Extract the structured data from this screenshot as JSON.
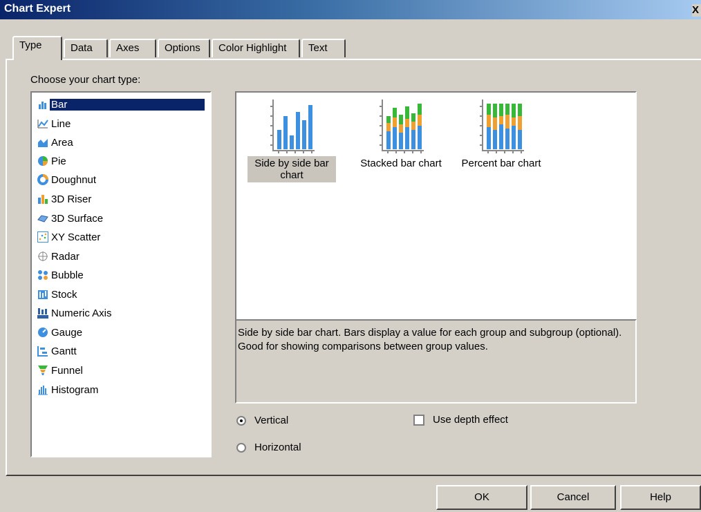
{
  "window": {
    "title": "Chart Expert",
    "close_symbol": "X"
  },
  "tabs": [
    {
      "label": "Type",
      "active": true
    },
    {
      "label": "Data"
    },
    {
      "label": "Axes"
    },
    {
      "label": "Options"
    },
    {
      "label": "Color Highlight"
    },
    {
      "label": "Text"
    }
  ],
  "chart_type_prompt": "Choose your chart type:",
  "chart_types": [
    {
      "label": "Bar",
      "icon": "bar-chart-icon",
      "selected": true
    },
    {
      "label": "Line",
      "icon": "line-chart-icon"
    },
    {
      "label": "Area",
      "icon": "area-chart-icon"
    },
    {
      "label": "Pie",
      "icon": "pie-chart-icon"
    },
    {
      "label": "Doughnut",
      "icon": "doughnut-chart-icon"
    },
    {
      "label": "3D Riser",
      "icon": "3d-riser-icon"
    },
    {
      "label": "3D Surface",
      "icon": "3d-surface-icon"
    },
    {
      "label": "XY Scatter",
      "icon": "xy-scatter-icon"
    },
    {
      "label": "Radar",
      "icon": "radar-icon"
    },
    {
      "label": "Bubble",
      "icon": "bubble-icon"
    },
    {
      "label": "Stock",
      "icon": "stock-icon"
    },
    {
      "label": "Numeric Axis",
      "icon": "numeric-axis-icon"
    },
    {
      "label": "Gauge",
      "icon": "gauge-icon"
    },
    {
      "label": "Gantt",
      "icon": "gantt-icon"
    },
    {
      "label": "Funnel",
      "icon": "funnel-icon"
    },
    {
      "label": "Histogram",
      "icon": "histogram-icon"
    }
  ],
  "bar_variants": [
    {
      "label": "Side by side bar chart",
      "selected": true
    },
    {
      "label": "Stacked bar chart"
    },
    {
      "label": "Percent bar chart"
    }
  ],
  "description": "Side by side bar chart. Bars display a value for each group and subgroup (optional). Good for showing comparisons between group values.",
  "orientation": {
    "vertical_label": "Vertical",
    "horizontal_label": "Horizontal",
    "selected": "Vertical"
  },
  "depth_effect": {
    "label": "Use depth effect",
    "checked": false
  },
  "buttons": {
    "ok": "OK",
    "cancel": "Cancel",
    "help": "Help"
  },
  "colors": {
    "selection": "#0a246a",
    "series_blue": "#3d8fe0",
    "series_orange": "#f0a030",
    "series_green": "#38b838"
  }
}
